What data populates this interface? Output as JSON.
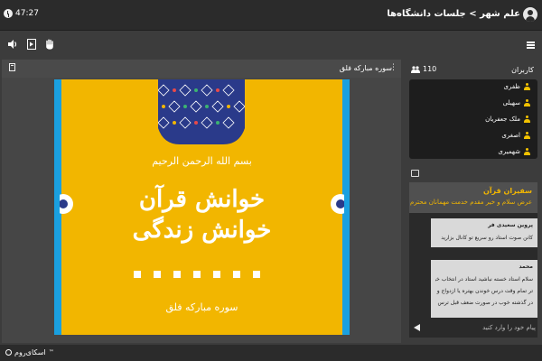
{
  "header": {
    "title": "علم شهر > جلسات دانشگاه‌ها",
    "timer": "47:27"
  },
  "main": {
    "slide_title": "سوره مبارکه فلق",
    "slide": {
      "bismillah": "بسم الله الرحمن الرحیم",
      "headline_1": "خوانش قرآن",
      "headline_2": "خوانش زندگی",
      "surah": "سوره مبارکه فلق"
    }
  },
  "users": {
    "label": "کاربران",
    "count": "110",
    "items": [
      {
        "name": "ظفری"
      },
      {
        "name": "سهیلی"
      },
      {
        "name": "ملک جعفریان"
      },
      {
        "name": "اصغری"
      },
      {
        "name": "شهمیری"
      }
    ]
  },
  "chat": {
    "header_title": "سفیران قرآن",
    "header_text": "عرض سلام و خیر مقدم خدمت مهمانان محترم",
    "messages": [
      {
        "sender": "پروین سعیدی فر",
        "text": "کانن صوت استاد رو سریع تو کانال بزارید"
      },
      {
        "sender": "محمد",
        "lines": [
          "سلام استاد خسته نباشید استاد در انتخاب خوب خوب",
          "تر تمام وقت درس خوندن بهتره یا ازدواج و کار و درس",
          "در گذشته خوب در صورت ضعف قبل ترس لطفا نه کاهش"
        ]
      }
    ],
    "input_placeholder": "پیام خود را وارد کنید"
  },
  "footer": {
    "brand": "اسکای‌روم",
    "reg_mark": "™"
  },
  "colors": {
    "accent": "#f2b600",
    "slide_bg": "#f2b600",
    "slide_border": "#1aa0e0",
    "topbar_bg": "#2b2b2b",
    "panel_bg": "#3c3c3c"
  },
  "icons": {
    "audio": "speaker-icon",
    "video": "video-icon",
    "raise_hand": "hand-icon",
    "menu": "hamburger-icon",
    "users": "users-icon",
    "chat": "chat-icon",
    "send": "send-icon"
  }
}
